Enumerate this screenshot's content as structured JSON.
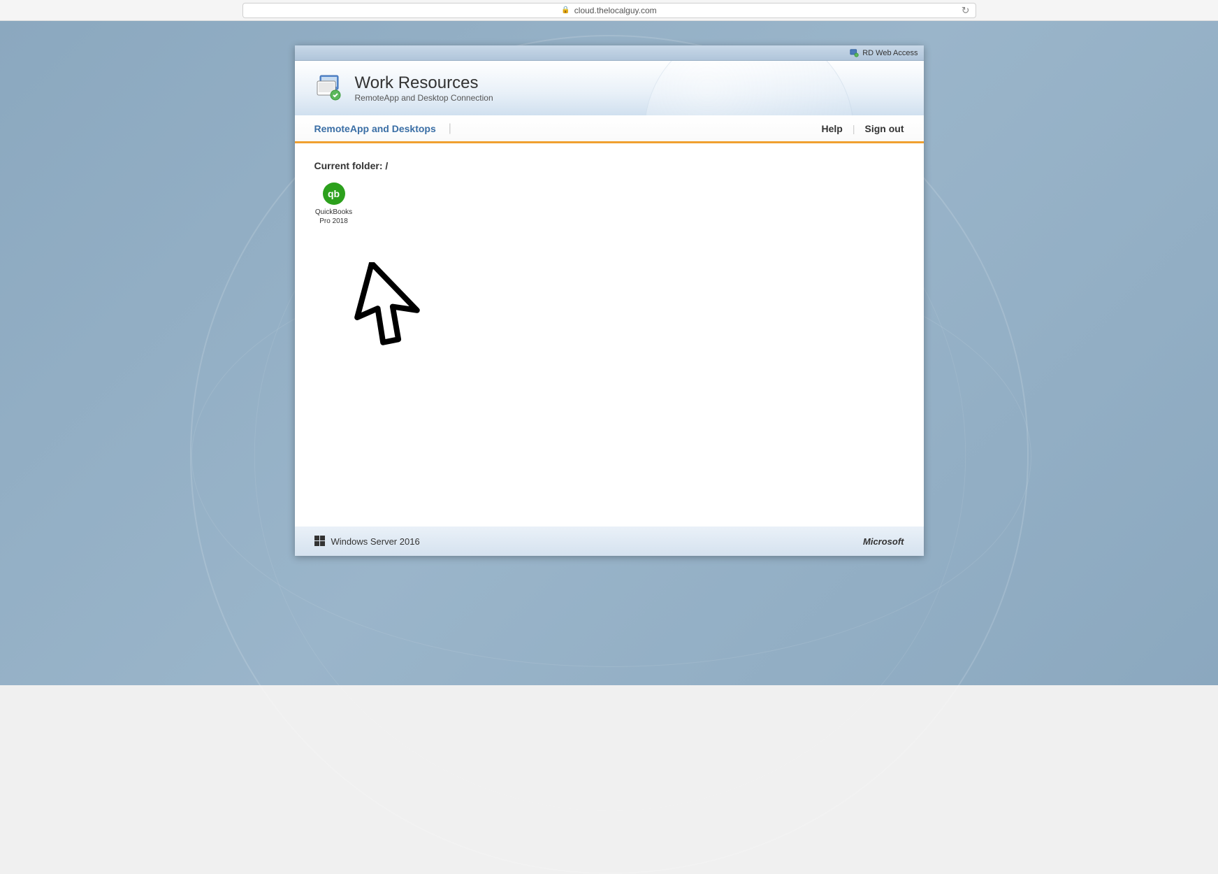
{
  "browser": {
    "url": "cloud.thelocalguy.com"
  },
  "topbar": {
    "label": "RD Web Access"
  },
  "header": {
    "title": "Work Resources",
    "subtitle": "RemoteApp and Desktop Connection"
  },
  "nav": {
    "tab": "RemoteApp and Desktops",
    "help": "Help",
    "signout": "Sign out"
  },
  "body": {
    "folder_label": "Current folder: /",
    "apps": [
      {
        "icon_text": "qb",
        "label": "QuickBooks Pro 2018"
      }
    ]
  },
  "footer": {
    "server": "Windows Server 2016",
    "brand": "Microsoft"
  }
}
